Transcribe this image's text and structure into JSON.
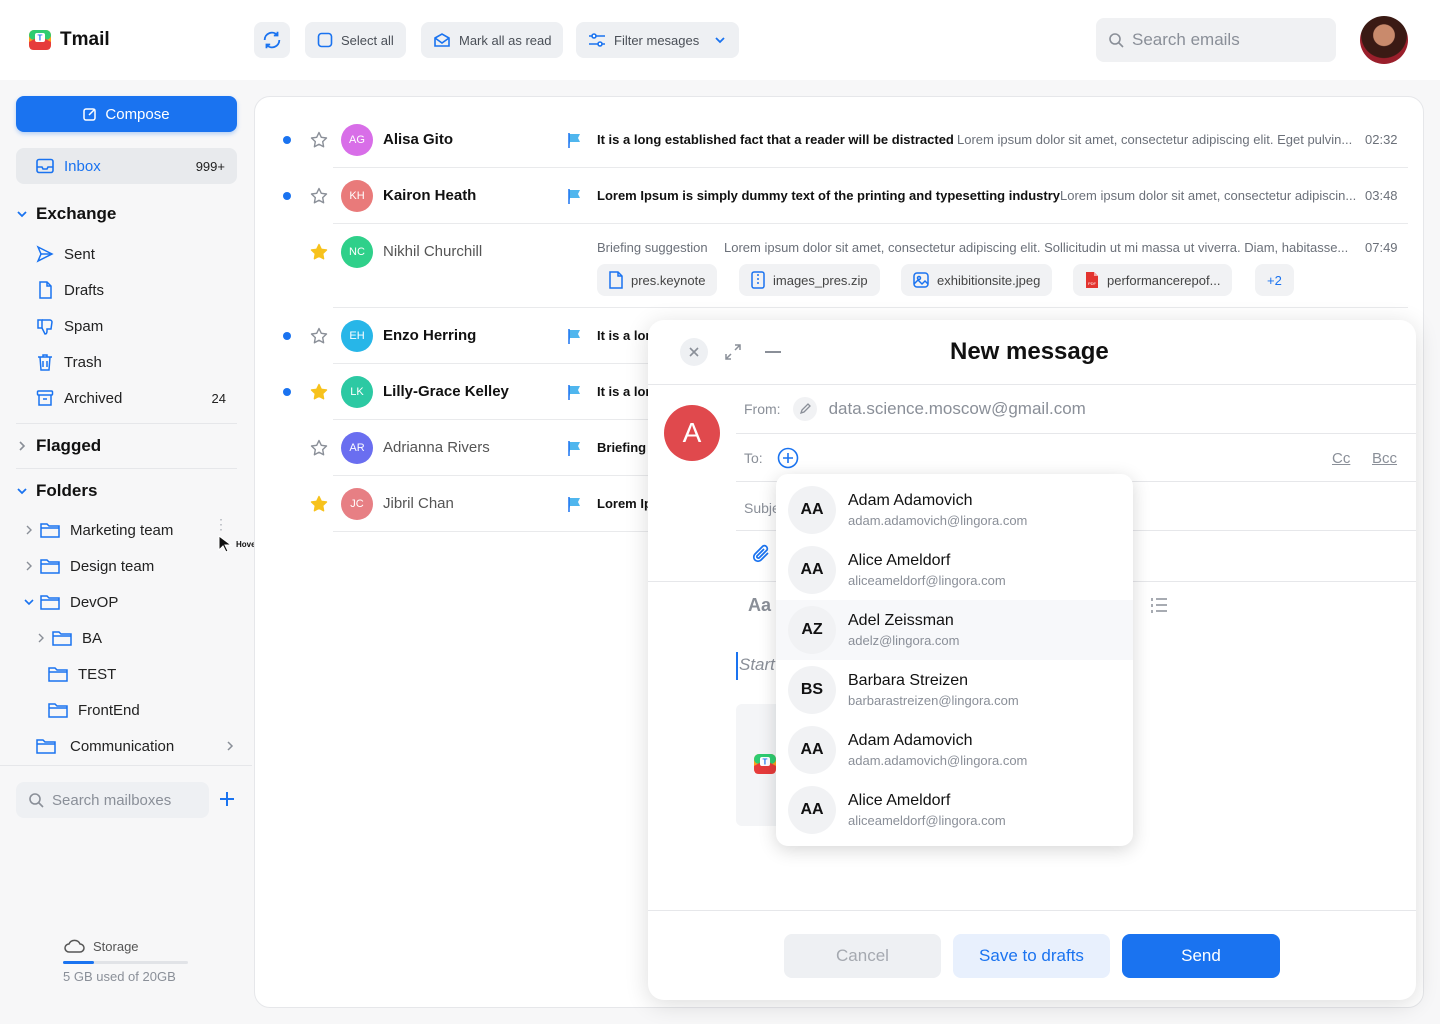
{
  "app": {
    "name": "Tmail"
  },
  "toolbar": {
    "select_all": "Select all",
    "mark_read": "Mark all as read",
    "filter": "Filter mesages",
    "search_placeholder": "Search emails"
  },
  "sidebar": {
    "compose": "Compose",
    "inbox": {
      "label": "Inbox",
      "count": "999+"
    },
    "exchange": {
      "title": "Exchange",
      "items": [
        {
          "label": "Sent",
          "count": ""
        },
        {
          "label": "Drafts",
          "count": ""
        },
        {
          "label": "Spam",
          "count": ""
        },
        {
          "label": "Trash",
          "count": ""
        },
        {
          "label": "Archived",
          "count": "24"
        }
      ]
    },
    "flagged": "Flagged",
    "folders": {
      "title": "Folders",
      "items": [
        "Marketing team",
        "Design team",
        "DevOP",
        "BA",
        "TEST",
        "FrontEnd",
        "Communication"
      ],
      "hover_label": "Hover"
    },
    "search_placeholder": "Search mailboxes",
    "storage": {
      "label": "Storage",
      "usage": "5 GB used of 20GB",
      "fraction": 0.25
    }
  },
  "emails": [
    {
      "initials": "AG",
      "name": "Alisa Gito",
      "subject": "It is a long established fact that a reader will be distracted",
      "preview": "Lorem ipsum dolor sit amet, consectetur adipiscing elit. Eget pulvin...",
      "time": "02:32",
      "unread": true,
      "starred": false,
      "color": "#d86ee8"
    },
    {
      "initials": "KH",
      "name": "Kairon Heath",
      "subject": "Lorem Ipsum is simply dummy text of the printing and typesetting industry",
      "preview": "Lorem ipsum dolor sit amet, consectetur adipiscin...",
      "time": "03:48",
      "unread": true,
      "starred": false,
      "color": "#e97a7a"
    },
    {
      "initials": "NC",
      "name": "Nikhil Churchill",
      "subject": "Briefing suggestion",
      "preview": "Lorem ipsum dolor sit amet, consectetur adipiscing elit. Sollicitudin ut mi massa ut viverra. Diam, habitasse...",
      "time": "07:49",
      "unread": false,
      "starred": true,
      "color": "#2fd08a"
    },
    {
      "initials": "EH",
      "name": "Enzo Herring",
      "subject": "It is a lon",
      "preview": "",
      "time": "",
      "unread": true,
      "starred": false,
      "color": "#27b6e8"
    },
    {
      "initials": "LK",
      "name": "Lilly-Grace Kelley",
      "subject": "It is a lon",
      "preview": "",
      "time": "",
      "unread": true,
      "starred": true,
      "color": "#2cc9a3"
    },
    {
      "initials": "AR",
      "name": "Adrianna Rivers",
      "subject": "Briefing s",
      "preview": "",
      "time": "",
      "unread": false,
      "starred": false,
      "color": "#6a6ef0"
    },
    {
      "initials": "JC",
      "name": "Jibril Chan",
      "subject": "Lorem Ip",
      "preview": "",
      "time": "",
      "unread": false,
      "starred": true,
      "color": "#e77f84"
    }
  ],
  "attachments": [
    "pres.keynote",
    "images_pres.zip",
    "exhibitionsite.jpeg",
    "performancerepof...",
    "+2"
  ],
  "compose": {
    "title": "New message",
    "avatar": "A",
    "from_label": "From:",
    "from_value": "data.science.moscow@gmail.com",
    "to_label": "To:",
    "cc": "Cc",
    "bcc": "Bcc",
    "subject_label": "Subje",
    "font_label": "Aa",
    "body_placeholder": "Start",
    "cancel": "Cancel",
    "save": "Save to drafts",
    "send": "Send"
  },
  "suggestions": [
    {
      "initials": "AA",
      "name": "Adam Adamovich",
      "email": "adam.adamovich@lingora.com"
    },
    {
      "initials": "AA",
      "name": "Alice Ameldorf",
      "email": "aliceameldorf@lingora.com"
    },
    {
      "initials": "AZ",
      "name": "Adel Zeissman",
      "email": "adelz@lingora.com"
    },
    {
      "initials": "BS",
      "name": "Barbara Streizen",
      "email": "barbarastreizen@lingora.com"
    },
    {
      "initials": "AA",
      "name": "Adam Adamovich",
      "email": "adam.adamovich@lingora.com"
    },
    {
      "initials": "AA",
      "name": "Alice Ameldorf",
      "email": "aliceameldorf@lingora.com"
    }
  ]
}
